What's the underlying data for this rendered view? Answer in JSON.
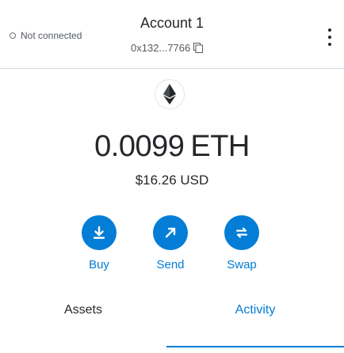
{
  "header": {
    "connection_status": "Not connected",
    "account_name": "Account 1",
    "account_address": "0x132...7766"
  },
  "balance": {
    "amount": "0.0099",
    "unit": "ETH",
    "fiat": "$16.26 USD"
  },
  "actions": [
    {
      "label": "Buy",
      "icon": "download-icon"
    },
    {
      "label": "Send",
      "icon": "arrow-up-right-icon"
    },
    {
      "label": "Swap",
      "icon": "swap-icon"
    }
  ],
  "tabs": [
    {
      "label": "Assets"
    },
    {
      "label": "Activity",
      "active": true
    }
  ],
  "colors": {
    "accent": "#037dd6",
    "text": "#24272a",
    "muted": "#535a61",
    "divider": "#d6d9dc"
  }
}
